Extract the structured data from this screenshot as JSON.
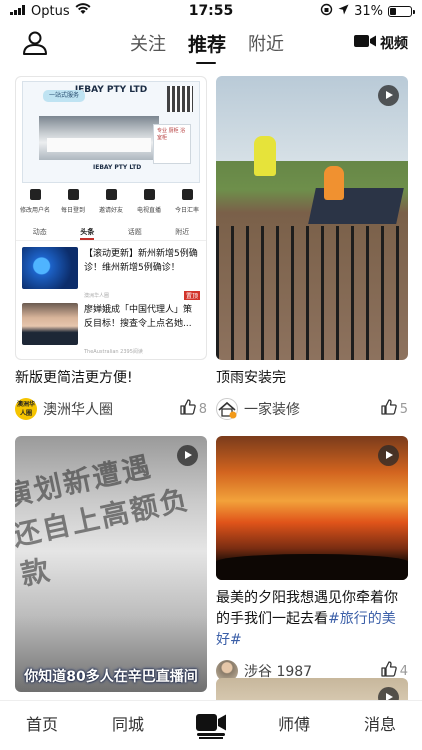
{
  "status_bar": {
    "carrier": "Optus",
    "time": "17:55",
    "battery_percent": "31%",
    "battery_level": 0.31
  },
  "top_nav": {
    "tabs": [
      {
        "label": "关注",
        "active": false
      },
      {
        "label": "推荐",
        "active": true
      },
      {
        "label": "附近",
        "active": false
      }
    ],
    "video_label": "视频"
  },
  "feed": [
    {
      "title": "新版更简洁更方便!",
      "author": "澳洲华人圈",
      "avatar_text": "澳洲华人圈",
      "likes": "8",
      "thumb": {
        "ad_title": "IEBAY PTY LTD",
        "ad_banner": "一站式服务",
        "ad_sign": "专业 厨柜 浴室柜",
        "ad_brand": "IEBAY PTY LTD",
        "icons": [
          "修改用户名",
          "每日登到",
          "邀请好友",
          "电视直播",
          "今日汇率"
        ],
        "tabs": [
          "动态",
          "头条",
          "话题",
          "附近"
        ],
        "news": [
          {
            "title": "【滚动更新】新州新增5例确诊！维州新增5例确诊！",
            "source": "澳洲华人圈",
            "tag": "置顶"
          },
          {
            "title": "廖婵娥成「中国代理人」策反目标！搜查令上点名她...",
            "source": "TheAustralian 2395阅读",
            "tag": ""
          }
        ]
      }
    },
    {
      "title": "顶雨安装完",
      "author": "一家装修",
      "likes": "5"
    },
    {
      "title": "",
      "author": "",
      "likes": "",
      "thumb": {
        "subtitle": "你知道80多人在辛巴直播间"
      }
    },
    {
      "title_text": "最美的夕阳我想遇见你牵着你的手我们一起去看",
      "hashtag": "#旅行的美好#",
      "author": "涉谷 1987",
      "likes": "4"
    }
  ],
  "bottom_nav": {
    "items": [
      "首页",
      "同城",
      "师傅",
      "消息"
    ]
  },
  "colors": {
    "accent_blue": "#3b5fa8",
    "tag_red": "#d2342b"
  }
}
